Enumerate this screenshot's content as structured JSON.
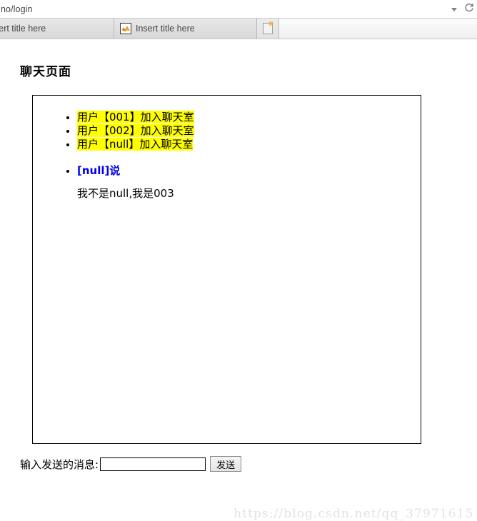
{
  "browser": {
    "url": "no/login",
    "dropdown_icon": "chevron-down-icon",
    "reload_icon": "reload-icon",
    "tabs": [
      {
        "title": "sert title here",
        "favicon": "page-favicon-icon",
        "active": false
      },
      {
        "title": "Insert title here",
        "favicon": "page-favicon-icon",
        "active": true
      }
    ],
    "new_tab_label": "new-tab-icon"
  },
  "page": {
    "heading": "聊天页面",
    "messages": [
      {
        "type": "join",
        "text": "用户【001】加入聊天室"
      },
      {
        "type": "join",
        "text": "用户【002】加入聊天室"
      },
      {
        "type": "join",
        "text": "用户【null】加入聊天室"
      },
      {
        "type": "say",
        "text": "[null]说"
      }
    ],
    "message_body": "我不是null,我是003",
    "send": {
      "label": "输入发送的消息:",
      "input_value": "",
      "input_placeholder": "",
      "button_label": "发送"
    },
    "colors": {
      "highlight": "#ffff00",
      "link": "#0000ee",
      "border": "#000000"
    }
  },
  "watermark": "https://blog.csdn.net/qq_37971615"
}
